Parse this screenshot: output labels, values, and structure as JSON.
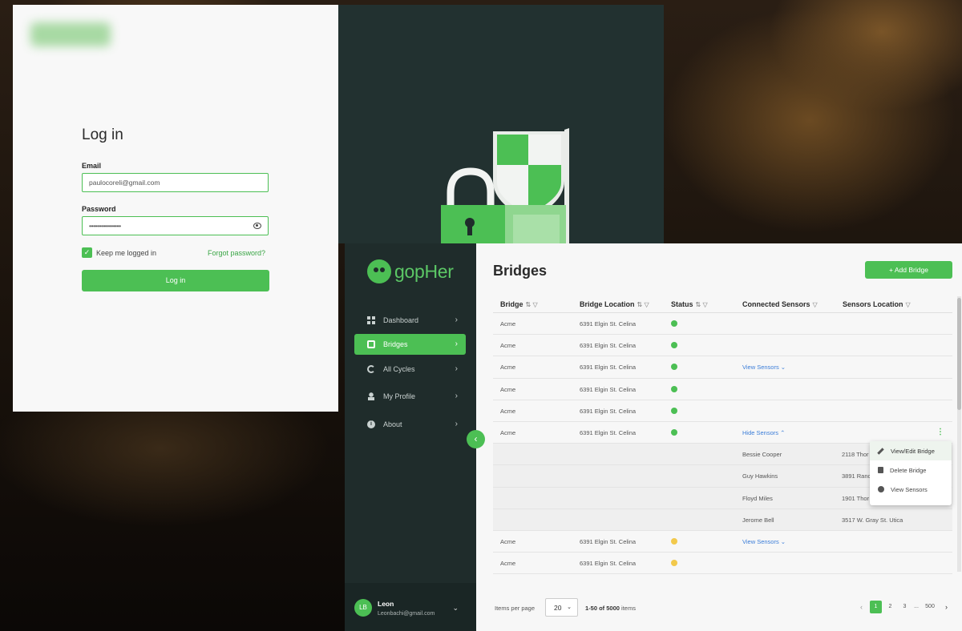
{
  "login": {
    "title": "Log in",
    "email_label": "Email",
    "email_value": "paulocoreli@gmail.com",
    "password_label": "Password",
    "password_value": "••••••••••••••••",
    "keep_logged_in": "Keep me logged in",
    "keep_checked": true,
    "forgot_password": "Forgot password?",
    "login_button": "Log in"
  },
  "app": {
    "brand": "gopHer",
    "nav": [
      {
        "label": "Dashboard",
        "icon": "dashboard-icon",
        "active": false
      },
      {
        "label": "Bridges",
        "icon": "chip-icon",
        "active": true
      },
      {
        "label": "All Cycles",
        "icon": "cycle-icon",
        "active": false
      },
      {
        "label": "My Profile",
        "icon": "profile-icon",
        "active": false
      },
      {
        "label": "About",
        "icon": "info-icon",
        "active": false
      }
    ],
    "user": {
      "initials": "LB",
      "name": "Leon",
      "email": "Leonbachi@gmail.com"
    },
    "page_title": "Bridges",
    "add_button": "+ Add Bridge",
    "columns": [
      "Bridge",
      "Bridge Location",
      "Status",
      "Connected Sensors",
      "Sensors Location"
    ],
    "rows": [
      {
        "bridge": "Acme",
        "location": "6391 Elgin St. Celina",
        "status": "green",
        "sensors": "",
        "sensor_location": ""
      },
      {
        "bridge": "Acme",
        "location": "6391 Elgin St. Celina",
        "status": "green",
        "sensors": "",
        "sensor_location": ""
      },
      {
        "bridge": "Acme",
        "location": "6391 Elgin St. Celina",
        "status": "green",
        "sensors": "View Sensors ⌄",
        "sensor_location": ""
      },
      {
        "bridge": "Acme",
        "location": "6391 Elgin St. Celina",
        "status": "green",
        "sensors": "",
        "sensor_location": ""
      },
      {
        "bridge": "Acme",
        "location": "6391 Elgin St. Celina",
        "status": "green",
        "sensors": "",
        "sensor_location": ""
      },
      {
        "bridge": "Acme",
        "location": "6391 Elgin St. Celina",
        "status": "green",
        "sensors": "Hide Sensors ⌃",
        "sensor_location": ""
      },
      {
        "bridge": "",
        "location": "",
        "status": "",
        "sensors": "Bessie Cooper",
        "sensor_location": "2118 Thor"
      },
      {
        "bridge": "",
        "location": "",
        "status": "",
        "sensors": "Guy Hawkins",
        "sensor_location": "3891 Ranc"
      },
      {
        "bridge": "",
        "location": "",
        "status": "",
        "sensors": "Floyd Miles",
        "sensor_location": "1901 Thor"
      },
      {
        "bridge": "",
        "location": "",
        "status": "",
        "sensors": "Jerome Bell",
        "sensor_location": "3517 W. Gray St. Utica"
      },
      {
        "bridge": "Acme",
        "location": "6391 Elgin St. Celina",
        "status": "yellow",
        "sensors": "View Sensors ⌄",
        "sensor_location": ""
      },
      {
        "bridge": "Acme",
        "location": "6391 Elgin St. Celina",
        "status": "yellow",
        "sensors": "",
        "sensor_location": ""
      }
    ],
    "context_menu": [
      "View/Edit Bridge",
      "Delete Bridge",
      "View Sensors"
    ],
    "footer": {
      "items_per_page_label": "Items per page",
      "items_per_page_value": "20",
      "range_text": "1-50 of 5000",
      "range_suffix": " items",
      "pages": [
        "1",
        "2",
        "3",
        "...",
        "500"
      ],
      "current_page": "1"
    }
  },
  "colors": {
    "accent": "#4cbf54",
    "sidebar": "#1f2c2b",
    "link": "#3b7dd8",
    "warning": "#f2c94c"
  }
}
